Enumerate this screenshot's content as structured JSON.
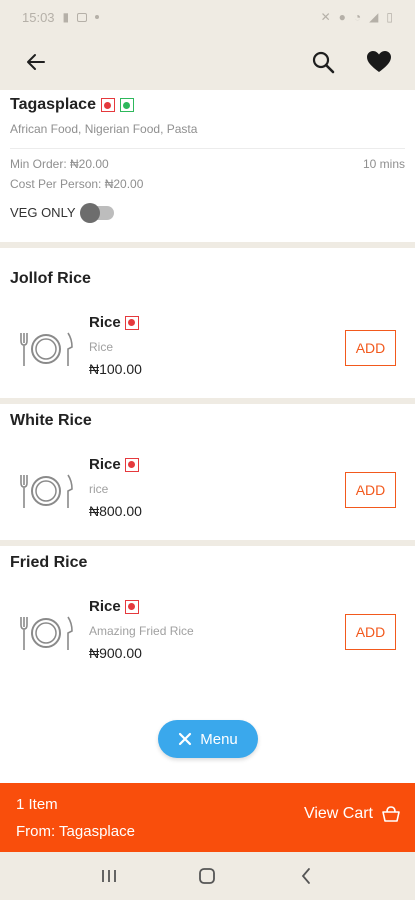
{
  "status_bar": {
    "time": "15:03"
  },
  "restaurant": {
    "name": "Tagasplace",
    "cuisine": "African Food, Nigerian Food, Pasta",
    "min_order": "Min Order: ₦20.00",
    "delivery_time": "10 mins",
    "cost_per_person": "Cost Per Person: ₦20.00",
    "veg_only_label": "VEG ONLY",
    "veg_only_enabled": false
  },
  "sections": [
    {
      "title": "Jollof Rice",
      "dish": {
        "name": "Rice",
        "description": "Rice",
        "price": "₦100.00",
        "add_label": "ADD"
      }
    },
    {
      "title": "White Rice",
      "dish": {
        "name": "Rice",
        "description": "rice",
        "price": "₦800.00",
        "add_label": "ADD"
      }
    },
    {
      "title": "Fried Rice",
      "dish": {
        "name": "Rice",
        "description": "Amazing Fried Rice",
        "price": "₦900.00",
        "add_label": "ADD"
      }
    }
  ],
  "menu_button": {
    "label": "Menu"
  },
  "cart": {
    "count": "1 Item",
    "from": "From: Tagasplace",
    "view_label": "View Cart"
  },
  "icons": {
    "back": "arrow-left-icon",
    "search": "search-icon",
    "favorite": "heart-icon",
    "dish_placeholder": "plate-cutlery-icon",
    "cart": "shopping-basket-icon",
    "menu": "close-icon",
    "nav": [
      "recents-icon",
      "home-icon",
      "back-icon"
    ]
  },
  "colors": {
    "accent": "#f94e0c",
    "menu_button": "#3aa8ec",
    "non_veg": "#e5393d",
    "veg": "#2eb85c",
    "header_bg": "#efebe3"
  }
}
